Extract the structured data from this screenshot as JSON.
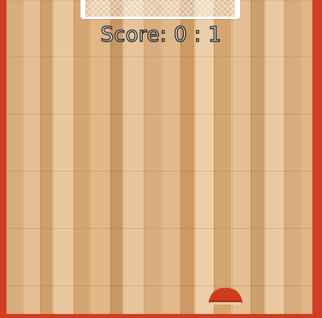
{
  "score": {
    "label": "Score:",
    "value": "0 : 1"
  },
  "colors": {
    "border": "#d23c22",
    "goal": "#ffffff",
    "paddle": "#cf3b1f"
  },
  "icons": {
    "goal": "goal-net-icon",
    "player": "player-paddle-icon"
  }
}
